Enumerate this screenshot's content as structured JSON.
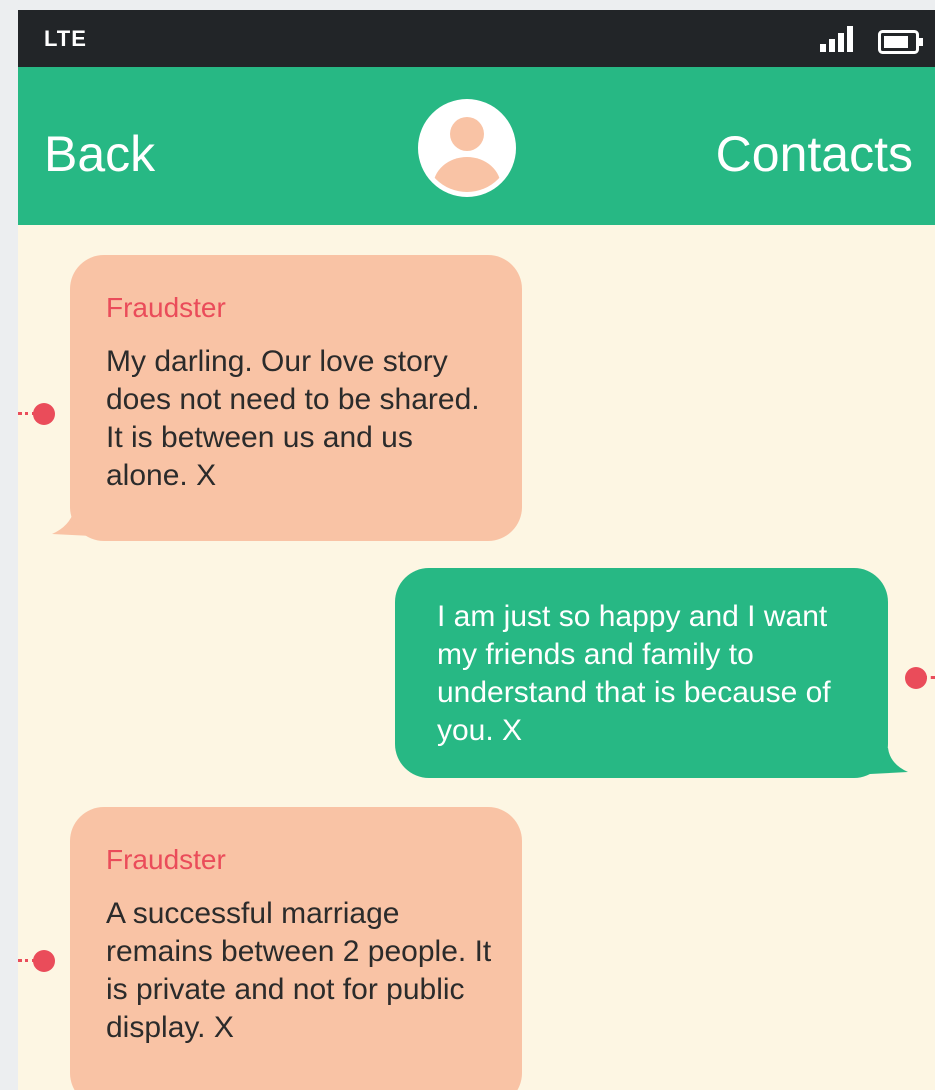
{
  "status_bar": {
    "network": "LTE",
    "icons": [
      "signal-icon",
      "battery-icon"
    ]
  },
  "header": {
    "back_label": "Back",
    "contacts_label": "Contacts",
    "avatar_icon": "user-avatar-icon"
  },
  "colors": {
    "header": "#27b884",
    "incoming_bubble": "#f9c3a5",
    "outgoing_bubble": "#27b884",
    "sender_name": "#ea4c5a",
    "chat_background": "#fdf6e3"
  },
  "messages": [
    {
      "sender": "Fraudster",
      "text": "My darling. Our love story does not need to be shared. It is between us and us alone. X"
    },
    {
      "sender": "",
      "text": "I am just so happy and I want my friends and family to understand that is because of you. X"
    },
    {
      "sender": "Fraudster",
      "text": "A successful marriage remains between 2 people. It is private and not for public display. X"
    }
  ]
}
